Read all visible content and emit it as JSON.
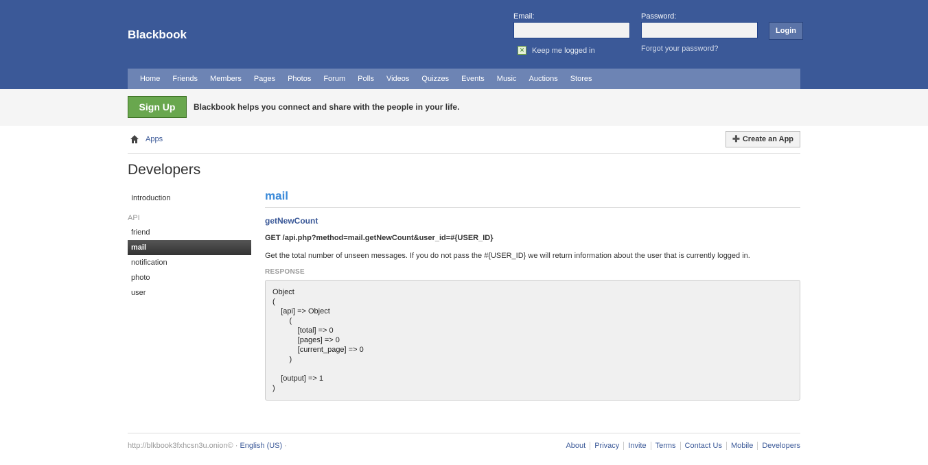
{
  "header": {
    "brand": "Blackbook",
    "email_label": "Email:",
    "password_label": "Password:",
    "keep_logged_in": "Keep me logged in",
    "forgot_password": "Forgot your password?",
    "login_button": "Login"
  },
  "nav": [
    "Home",
    "Friends",
    "Members",
    "Pages",
    "Photos",
    "Forum",
    "Polls",
    "Videos",
    "Quizzes",
    "Events",
    "Music",
    "Auctions",
    "Stores"
  ],
  "signup": {
    "button": "Sign Up",
    "tagline": "Blackbook helps you connect and share with the people in your life."
  },
  "breadcrumb": {
    "apps": "Apps"
  },
  "create_app": "Create an App",
  "page_title": "Developers",
  "sidebar": {
    "intro": "Introduction",
    "api_heading": "API",
    "items": [
      "friend",
      "mail",
      "notification",
      "photo",
      "user"
    ],
    "active": "mail"
  },
  "content": {
    "section_title": "mail",
    "method_name": "getNewCount",
    "endpoint": "GET /api.php?method=mail.getNewCount&user_id=#{USER_ID}",
    "description": "Get the total number of unseen messages. If you do not pass the #{USER_ID} we will return information about the user that is currently logged in.",
    "response_label": "RESPONSE",
    "response_body": "Object\n(\n    [api] => Object\n        (\n            [total] => 0\n            [pages] => 0\n            [current_page] => 0\n        )\n\n    [output] => 1\n)"
  },
  "footer": {
    "site": "http://blkbook3fxhcsn3u.onion© · ",
    "language": "English (US)",
    "language_suffix": " ·",
    "links": [
      "About",
      "Privacy",
      "Invite",
      "Terms",
      "Contact Us",
      "Mobile",
      "Developers"
    ]
  }
}
